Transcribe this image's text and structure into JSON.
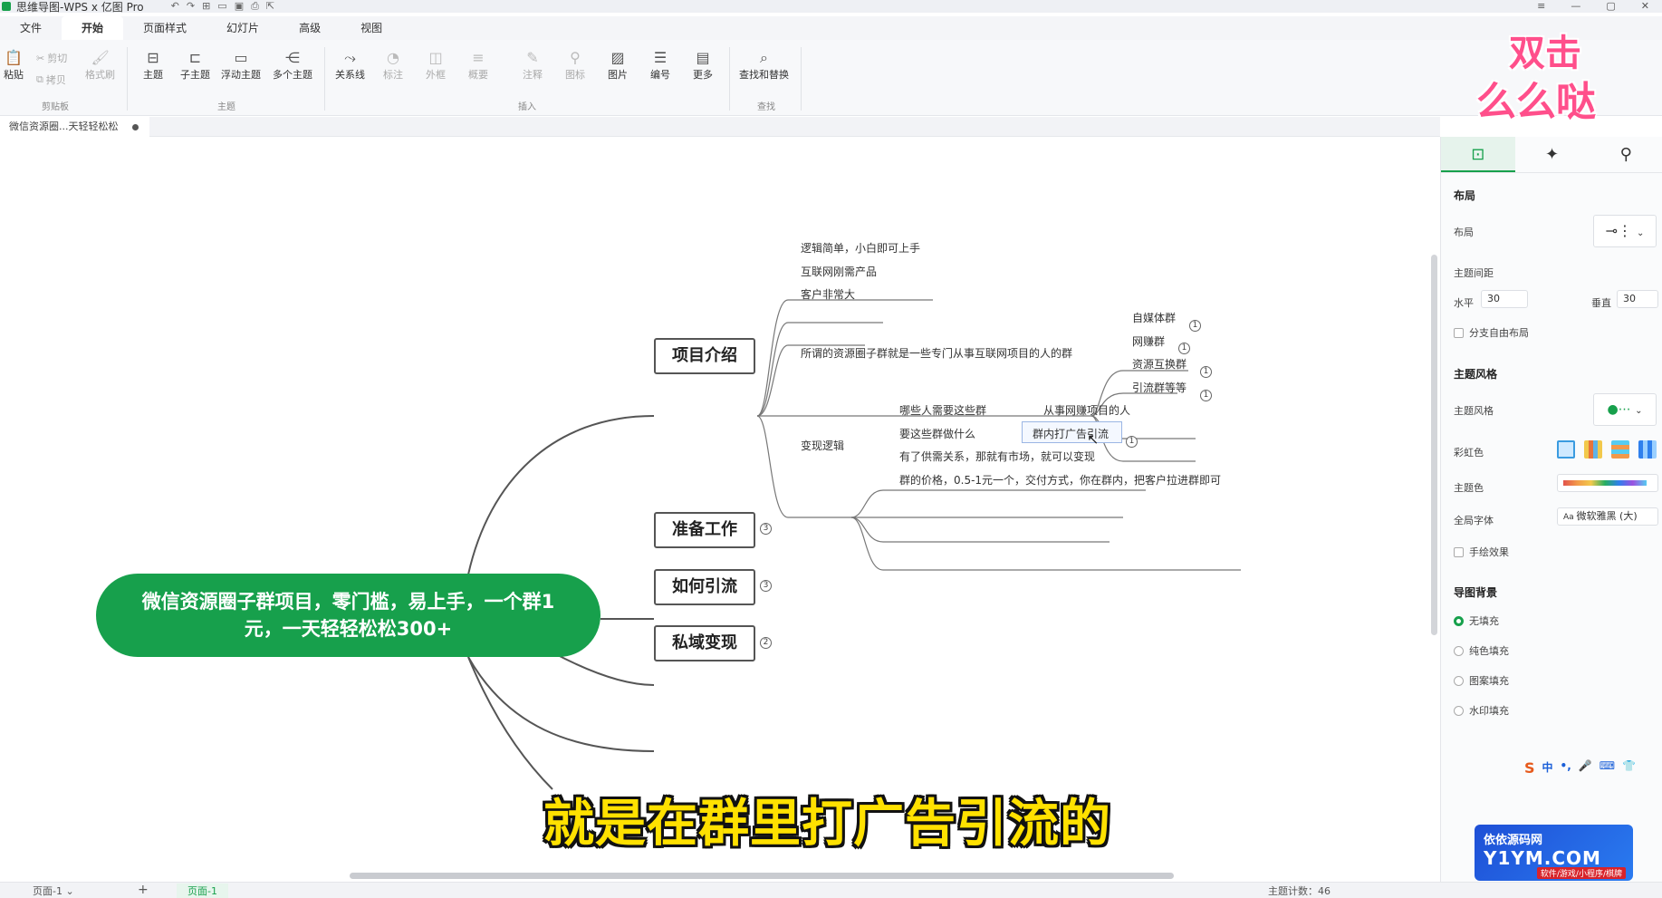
{
  "window": {
    "title": "思维导图-WPS x 亿图 Pro"
  },
  "menu": {
    "tabs": [
      "文件",
      "开始",
      "页面样式",
      "幻灯片",
      "高级",
      "视图"
    ],
    "active": "开始"
  },
  "ribbon": {
    "clipboard": {
      "paste": "粘贴",
      "cut": "剪切",
      "copy": "拷贝",
      "format_painter": "格式刷",
      "label": "剪贴板"
    },
    "topic": {
      "topic": "主题",
      "subtopic": "子主题",
      "floating": "浮动主题",
      "multi": "多个主题",
      "label": "主题"
    },
    "insert": {
      "relation": "关系线",
      "mark": "标注",
      "boundary": "外框",
      "summary": "概要",
      "note": "注释",
      "icon": "图标",
      "image": "图片",
      "numbering": "编号",
      "more": "更多",
      "label": "插入"
    },
    "find": {
      "find_replace": "查找和替换",
      "label": "查找"
    }
  },
  "doc_tab": {
    "label": "微信资源圈...天轻轻松松"
  },
  "mindmap": {
    "central": "微信资源圈子群项目，零门槛，易上手，一个群1元，一天轻轻松松300+",
    "topics": {
      "intro": "项目介绍",
      "prep": "准备工作",
      "traffic": "如何引流",
      "private": "私域变现"
    },
    "badges": {
      "prep": "3",
      "traffic": "3",
      "private": "2"
    },
    "intro_children": {
      "c1": "逻辑简单，小白即可上手",
      "c2": "互联网刚需产品",
      "c3": "客户非常大",
      "c4": "所谓的资源圈子群就是一些专门从事互联网项目的人的群",
      "c5": "变现逻辑"
    },
    "group_types": {
      "g1": "自媒体群",
      "g2": "网赚群",
      "g3": "资源互换群",
      "g4": "引流群等等",
      "badge": "1"
    },
    "monetize": {
      "m1": "哪些人需要这些群",
      "m1a": "从事网赚项目的人",
      "m2": "要这些群做什么",
      "m2a": "群内打广告引流",
      "m2a_badge": "1",
      "m3": "有了供需关系，那就有市场，就可以变现",
      "m4": "群的价格，0.5-1元一个，交付方式，你在群内，把客户拉进群即可"
    }
  },
  "caption": "就是在群里打广告引流的",
  "status": {
    "page_select": "页面-1",
    "page_tab": "页面-1",
    "count": "主题计数：46"
  },
  "panel": {
    "layout_section": "布局",
    "layout_label": "布局",
    "spacing_label": "主题间距",
    "horizontal_label": "水平",
    "horizontal_value": "30",
    "vertical_label": "垂直",
    "vertical_value": "30",
    "free_layout": "分支自由布局",
    "style_section": "主题风格",
    "style_label": "主题风格",
    "rainbow_label": "彩虹色",
    "theme_color_label": "主题色",
    "font_label": "全局字体",
    "font_value": "微软雅黑 (大)",
    "hand_drawn": "手绘效果",
    "bg_section": "导图背景",
    "bg_none": "无填充",
    "bg_solid": "纯色填充",
    "bg_pattern": "图案填充",
    "bg_watermark": "水印填充"
  },
  "overlay": {
    "sticker_line1": "双击",
    "sticker_line2": "么么哒",
    "watermark_line1": "依依源码网",
    "watermark_line2": "Y1YM.COM",
    "watermark_line3": "软件/游戏/小程序/棋牌",
    "ime": [
      "中",
      "•,",
      "🎤",
      "⌨",
      "👕"
    ]
  },
  "colors": {
    "accent": "#17a04c",
    "caption": "#ffe100"
  }
}
